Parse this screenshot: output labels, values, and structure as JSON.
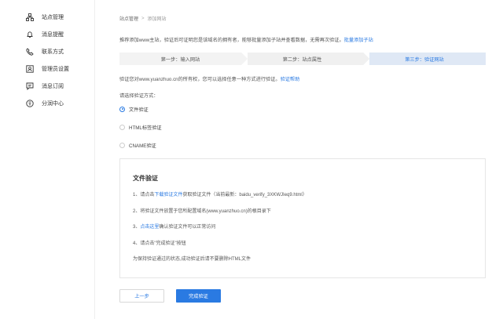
{
  "sidebar": {
    "items": [
      {
        "label": "站点管理",
        "icon": "sitemap-icon"
      },
      {
        "label": "消息提醒",
        "icon": "bell-icon"
      },
      {
        "label": "联系方式",
        "icon": "phone-icon"
      },
      {
        "label": "管理员设置",
        "icon": "admin-icon"
      },
      {
        "label": "消息订阅",
        "icon": "subscribe-icon"
      },
      {
        "label": "分润中心",
        "icon": "coin-icon"
      }
    ]
  },
  "breadcrumb": {
    "parent": "站点管理",
    "separator": ">",
    "current": "添加网站"
  },
  "notice": {
    "text": "推荐添加www主站，验证后可证明您是该域名的拥有者，能够批量添加子站并查看数据，无需再次验证。",
    "link": "批量添加子站"
  },
  "steps": [
    {
      "label": "第一步：输入网站"
    },
    {
      "label": "第二步：站点属性"
    },
    {
      "label": "第三步：验证网站"
    }
  ],
  "verify": {
    "text": "验证您对www.yuanzhuo.cn的所有权，您可以选择任意一种方式进行验证。",
    "help_link": "验证帮助"
  },
  "method": {
    "label": "请选择验证方式：",
    "options": [
      {
        "label": "文件验证",
        "checked": true
      },
      {
        "label": "HTML标签验证",
        "checked": false
      },
      {
        "label": "CNAME验证",
        "checked": false
      }
    ]
  },
  "panel": {
    "title": "文件验证",
    "line1_prefix": "1、请点击",
    "line1_link": "下载验证文件",
    "line1_suffix": "获取验证文件（当前最新：baidu_verify_3XKWJIeq9.html）",
    "line2": "2、将验证文件放置于您所配置域名(www.yuanzhuo.cn)的根目录下",
    "line3_prefix": "3、",
    "line3_link": "点击这里",
    "line3_suffix": "确认验证文件可以正常访问",
    "line4": "4、请点击\"完成验证\"按钮",
    "note": "为保持验证通过的状态,成功验证后请不要删除HTML文件"
  },
  "buttons": {
    "prev": "上一步",
    "done": "完成验证"
  },
  "colors": {
    "accent": "#2a7ae2",
    "active_step_bg": "#dfe8f5"
  }
}
